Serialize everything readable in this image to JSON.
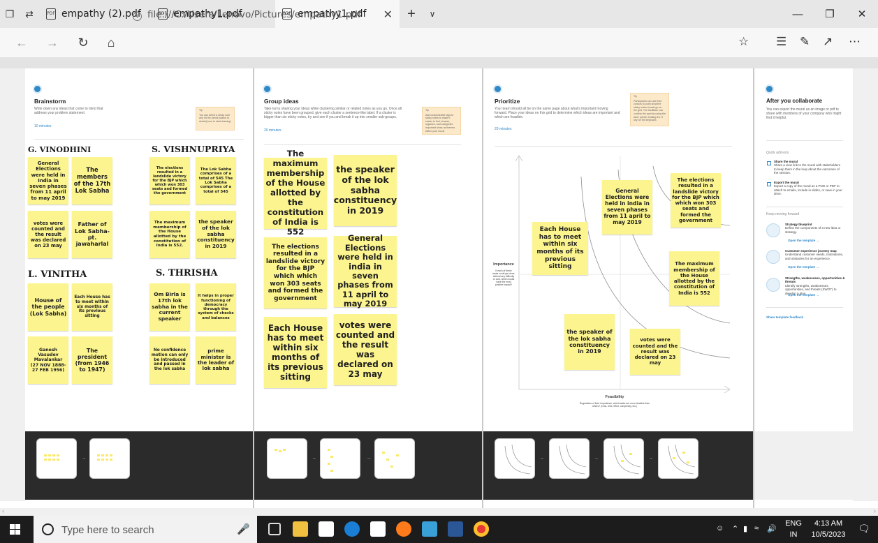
{
  "browser": {
    "tabs": [
      {
        "label": "empathy (2).pdf",
        "active": false
      },
      {
        "label": "empathy1.pdf",
        "active": false
      },
      {
        "label": "empathy1.pdf",
        "active": true
      }
    ],
    "url": "file:///C:/Users/Lenovo/Pictures/empathy1.pdf"
  },
  "brainstorm": {
    "title": "Brainstorm",
    "desc": "Write down any ideas that come to mind that address your problem statement.",
    "timer": "10 minutes",
    "tip_label": "Tip",
    "tip": "You can select a sticky note and hit the pencil [switch to sketch] icon to start drawing!",
    "names": [
      "G. VINODHINI",
      "S. VISHNUPRIYA",
      "L. VINITHA",
      "S. THRISHA"
    ],
    "notes_vinodhini": [
      "General Elections were held in India in seven phases from 11 april to may 2019",
      "The members of the 17th Lok Sabha",
      "votes were counted and the result was declared on 23 may",
      "Father of Lok Sabha-pt. jawaharlal"
    ],
    "notes_vishnupriya": [
      "The elections resulted in a landslide victory for the BJP which which won 303 seats and formed the government",
      "The Lok Sabha comprises of a total of 545 The Lok Sabha comprises of a total of 545",
      "The maximum membership of the House allotted by the constitution of India is 552.",
      "the speaker of the lok sabha constituency in 2019"
    ],
    "notes_vinitha": [
      "House of the people (Lok Sabha)",
      "Each House has to meet within six months of its previous sitting",
      "Ganesh Vasudev Mavalankar (27 NOV 1888- 27 FEB 1956)",
      "The president (from 1946 to 1947)"
    ],
    "notes_thrisha": [
      "Om Birla is 17th lok sabha in the current speaker",
      "It helps in proper functioning of democracy through the system of checks and balances",
      "No confidence motion can only be introduced and passed in the lok sabha",
      "prime minister is the leader of lok sabha"
    ]
  },
  "group": {
    "title": "Group ideas",
    "desc": "Take turns sharing your ideas while clustering similar or related notes as you go. Once all sticky notes have been grouped, give each cluster a sentence-like label. If a cluster is bigger than six sticky notes, try and see if you and break it up into smaller sub-groups.",
    "timer": "20 minutes",
    "tip_label": "Tip",
    "tip": "Add customizable tags to sticky notes to make it easier to find, browse, organize, and categorize important ideas as themes within your mural.",
    "notes": [
      "The maximum membership of the House allotted by the constitution of India is 552",
      "the speaker of the lok sabha constituency in 2019",
      "The elections resulted in a landslide victory for the BJP which which won 303 seats and formed the government",
      "General Elections were held in india in seven phases from 11 april to may 2019",
      "Each House has to meet within six months of its previous sitting",
      "votes were counted and the result was declared on 23 may"
    ]
  },
  "prioritize": {
    "title": "Prioritize",
    "desc": "Your team should all be on the same page about what's important moving forward. Place your ideas on this grid to determine which ideas are important and which are feasible.",
    "timer": "20 minutes",
    "tip_label": "Tip",
    "tip": "Participants can use their cursors to point at where sticky notes should go on the grid. The facilitator can confirm the spot by using the laser pointer holding the H key on the keyboard.",
    "y_label": "Importance",
    "y_desc": "If each of these tasks could get done without any difficulty or cost, which would have the most positive impact?",
    "x_label": "Feasibility",
    "x_desc": "Regardless of their importance, which tasks are more feasible than others? (Cost, time, effort, complexity, etc.)",
    "notes": [
      "General Elections were held in india in seven phases from 11 april to may 2019",
      "The elections resulted in a landslide victory for the BJP which which won 303 seats and formed the government",
      "Each House has to meet within six months of its previous sitting",
      "The maximum membership of the House allotted by the constitution of India is 552",
      "the speaker of the lok sabha constituency in 2019",
      "votes were counted and the result was declared on 23 may"
    ]
  },
  "after": {
    "title": "After you collaborate",
    "desc": "You can export the mural as an image or pdf to share with members of your company who might find it helpful.",
    "quick_head": "Quick add-ons",
    "share_title": "Share the mural",
    "share_desc": "Share a view link to the mural with stakeholders to keep them in the loop about the outcomes of the session.",
    "export_title": "Export the mural",
    "export_desc": "Export a copy of the mural as a PNG or PDF to attach to emails, include in slides, or save in your drive.",
    "keep_head": "Keep moving forward",
    "items": [
      {
        "title": "Strategy blueprint",
        "desc": "Define the components of a new idea or strategy.",
        "link": "Open the template →"
      },
      {
        "title": "Customer experience journey map",
        "desc": "Understand customer needs, motivations, and obstacles for an experience.",
        "link": "Open the template →"
      },
      {
        "title": "Strengths, weaknesses, opportunities & threats",
        "desc": "Identify strengths, weaknesses, opportunities, and threats (SWOT) to develop a plan.",
        "link": "Open the template →"
      }
    ],
    "feedback": "Share template feedback"
  },
  "taskbar": {
    "search_placeholder": "Type here to search",
    "lang_top": "ENG",
    "lang_bot": "IN",
    "time": "4:13 AM",
    "date": "10/5/2023"
  }
}
